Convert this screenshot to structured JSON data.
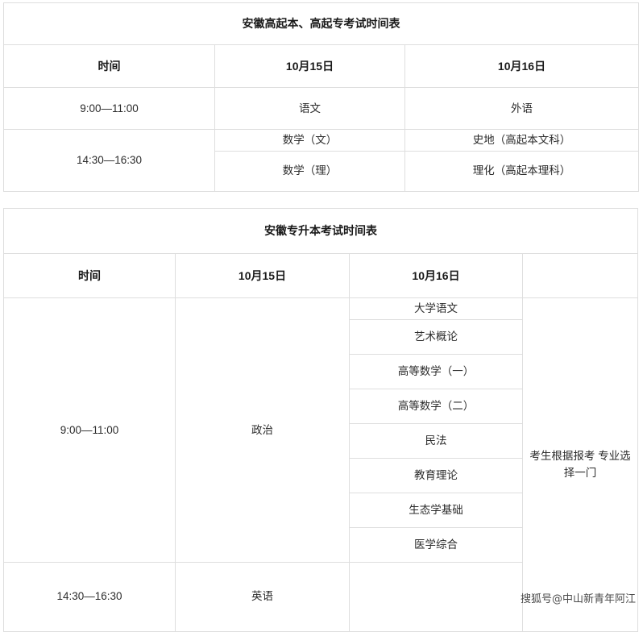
{
  "tables": [
    {
      "id": "gaoqi",
      "title": "安徽高起本、高起专考试时间表",
      "columns": [
        "时间",
        "10月15日",
        "10月16日"
      ],
      "rows": [
        {
          "time": "9:00—11:00",
          "d15": "语文",
          "d16": "外语"
        },
        {
          "time": "14:30—16:30",
          "d15": "数学（文）",
          "d16": "史地（高起本文科）"
        },
        {
          "time": "",
          "d15": "数学（理）",
          "d16": "理化（高起本理科）"
        }
      ]
    },
    {
      "id": "zhuanshengben",
      "title": "安徽专升本考试时间表",
      "columns": [
        "时间",
        "10月15日",
        "10月16日",
        ""
      ],
      "morning": {
        "time": "9:00—11:00",
        "d15": "政治",
        "subjects": [
          "大学语文",
          "艺术概论",
          "高等数学（一）",
          "高等数学（二）",
          "民法",
          "教育理论",
          "生态学基础",
          "医学综合"
        ],
        "note": "考生根据报考 专业选择一门"
      },
      "afternoon": {
        "time": "14:30—16:30",
        "d15": "英语",
        "d16": ""
      }
    }
  ],
  "watermark": {
    "prefix": "搜狐号",
    "at": "@",
    "account": "中山新青年阿江"
  },
  "colors": {
    "border": "#dedede",
    "text": "#2b2b2b",
    "heading": "#1a1a1a",
    "background": "#ffffff"
  }
}
